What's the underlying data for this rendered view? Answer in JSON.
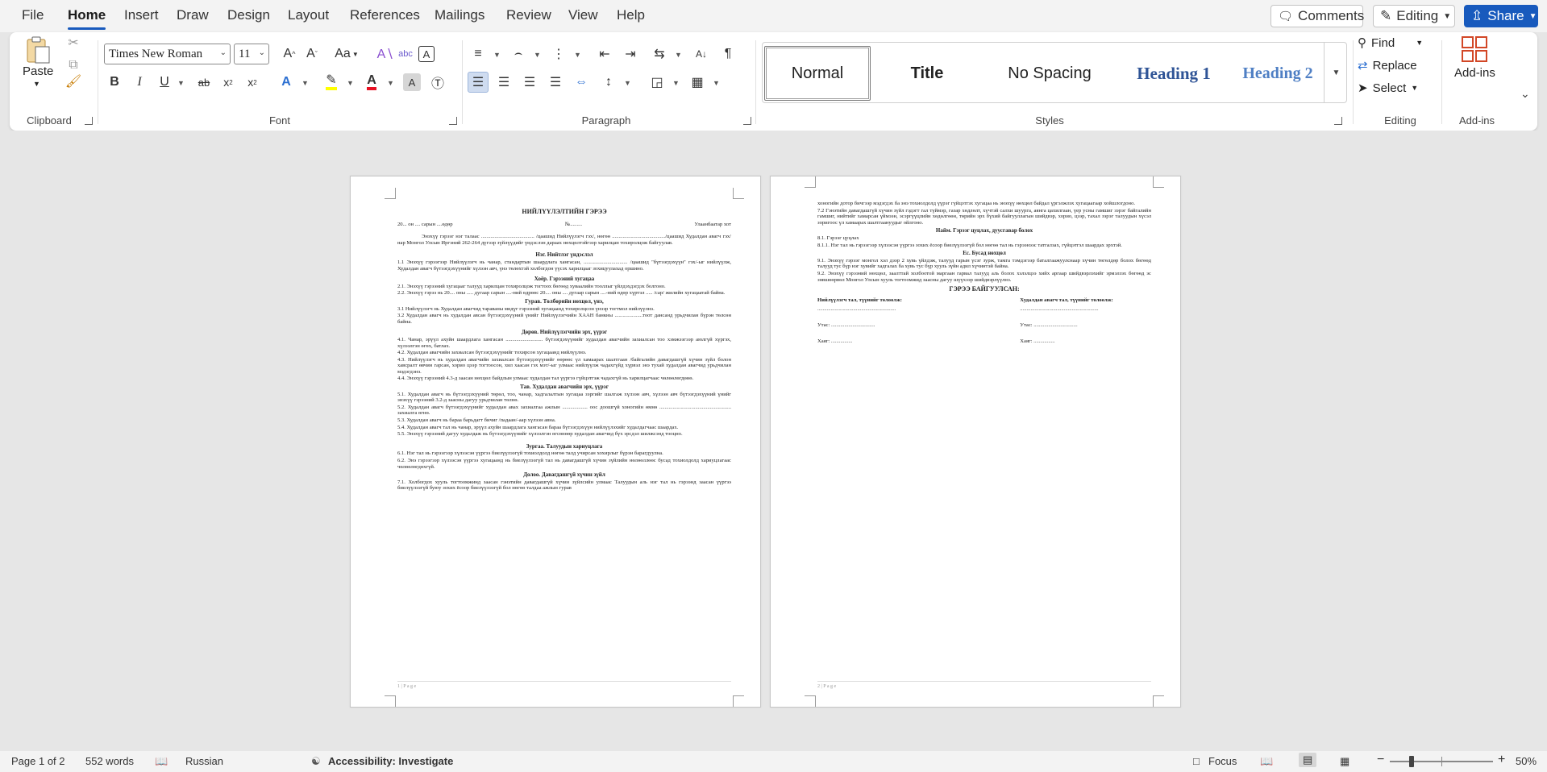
{
  "menu": {
    "tabs": [
      "File",
      "Home",
      "Insert",
      "Draw",
      "Design",
      "Layout",
      "References",
      "Mailings",
      "Review",
      "View",
      "Help"
    ],
    "comments_label": "Comments",
    "editing_label": "Editing",
    "share_label": "Share"
  },
  "ribbon": {
    "clipboard": {
      "paste_label": "Paste",
      "group_label": "Clipboard"
    },
    "font": {
      "font_name": "Times New Roman",
      "font_size": "11",
      "change_case": "Aa",
      "group_label": "Font"
    },
    "paragraph": {
      "group_label": "Paragraph"
    },
    "styles": {
      "group_label": "Styles",
      "items": [
        "Normal",
        "Title",
        "No Spacing",
        "Heading 1",
        "Heading 2"
      ]
    },
    "editing": {
      "find": "Find",
      "replace": "Replace",
      "select": "Select",
      "group_label": "Editing"
    },
    "addins": {
      "label": "Add-ins",
      "group_label": "Add-ins"
    }
  },
  "document": {
    "page1": {
      "title": "НИЙЛҮҮЛЭЛТИЙН ГЭРЭЭ",
      "date_line": "20... он .... сарын ....өдөр",
      "number": "№.........",
      "city": "Улаанбаатар хот",
      "intro": "Энэхүү гэрээг нэг талаас ........................................ /цаашид Нийлүүлэгч гэх/, нөгөө ......................................../цаашид Худалдан авагч гэх/ нар Монгол Улсын Иргэний 262-264 дүгээр зүйлүүдийг үндэслэн дараах нөхцөлтэйгээр харилцан тохиролцож байгуулав.",
      "s1_title": "Нэг. Нийтлэг үндэслэл",
      "s1_1": "1.1 Энэхүү гэрээгээр Нийлүүлэгч нь чанар, стандартын шаардлага хангасан, ................................. /цаашид \"бүтээгдэхүүн\" гэх/-ыг нийлүүлж, Худалдан авагч бүтээгдэхүүнийг хүлээн авч, үнэ төлөхтэй холбогдон үүсэх харилцааг зохицуулахад оршино.",
      "s2_title": "Хоёр. Гэрээний хугацаа",
      "s2_1": "2.1. Энэхүү гэрээний хугацааг талууд харилцан тохиролцож тогтоох бөгөөд хуваалийн тооллыг үйлдэхдэгдэх болгоно.",
      "s2_2": "2.2. Энэхүү гэрээ нь 20.... оны ..... дугаар сарын ....-ний өдрөөс 20.... оны .... дугаар сарын ....-ний өдөр хүртэл ..... /сар/ жилийн хугацаатай байна.",
      "s3_title": "Гурав. Төлбөрийн нөхцөл, үнэ,",
      "s3_1": "3.1 Нийлүүлэгч нь Худалдан авагчид тараваны мөдүг гэрээний хугацаанд тохиролцсон үнээр тогтмол нийлүүлнэ.",
      "s3_2": "3.2 Худалдан авагч нь худалдан авсан бүтээгдэхүүний үнийг Нийлүүлэгчийн ХААН банкны .....................тоот дансанд урьдчилан бүрэн төлсөн байна.",
      "s4_title": "Дөрөв. Нийлүүлэгчийн эрх, үүрэг",
      "s4_1": "4.1. Чанар, эрүүл ахуйн шаардлага хангасан ............................ бүтээгдэхүүнийг худалдан авагчийн захиалсан тоо хэмжээгээр аюлгүй хүргэх, хүлээлгэн өгөх, батлах.",
      "s4_2": "4.2. Худалдан авагчийн захиалсан бүтээгдэхүүнийг тохирсон хугацаанд нийлүүлнэ.",
      "s4_3": "4.3. Нийлүүлэгч нь худалдан авагчийн захиалсан бүтээгдэхүүнийг өөрөөс үл хамаарах шалтгаан /байгалийн давагдашгүй хүчин зүйл болон хавсралт өвчин гарсан, хорио цээр тогтоосон, хил хаасан гэх мэт/-ыг улмаас нийлүүлж чадахгүйд хүрвэл энэ тухай худалдан авагчид урьдчилан мэдэгдэнэ.",
      "s4_4": "4.4. Энэхүү гэрээний 4.3-д заасан нөхцөл байдлын улмаас худалдан тал үүргээ гүйцэтгэж чадахгүй нь харилцагчаас чөлөөлөгдөнө.",
      "s5_title": "Тав. Худалдан авагчийн эрх, үүрэг",
      "s5_1": "5.1. Худалдан авагч нь бүтээгдэхүүний төрөл, тоо, чанар, хадгалалтын хугацаа зэргийг шалгаж хүлээн авч, хүлээн авч бүтээгдэхүүний үнийг энэхүү гэрээний 3.2-д заасны дагуу урьдчилан төлнө.",
      "s5_2": "5.2. Худалдан авагч бүтээгдэхүүнийг худалдан авах захиалгаа ажлын ................... оос доошгүй хоногийн өмнө ...................................................... захиалга өгнө.",
      "s5_3": "5.3. Худалдан авагч нь бараа барьдагт бичиг /падаан/-аар хүлээн авна.",
      "s5_4": "5.4. Худалдан авагч тал нь чанар, эрүүл ахуйн шаардлага хангасан бараа бүтээгдэхүүн нийлүүлэхийг худалдагчаас шаардах.",
      "s5_5": "5.5. Энэхүү гэрээний дагуу худалдаж нь бүтээгдэхүүнийг хүлээлгэн өгсөнөөр худалдан авагчид бүх эрсдэл шилжсэнд тооцно.",
      "s6_title": "Зургаа. Талуудын хариуцлага",
      "s6_1": "6.1. Нэг тал нь гэрээгээр хүлээсэн үүргээ биелүүлээгүй тохиолдолд нөгөө талд учирсан хохирлыг бүрэн барагдуулна.",
      "s6_2": "6.2. Энэ гэрээгээр хүлээсэн үүргээ хугацаанд нь биелүүлээгүй тал нь давагдашгүй хүчин зүйлийн нөлөөллөөс бусад тохиолдолд хариуцлагаас чөлөөлөгдөхгүй.",
      "s7_title": "Долоо. Давагдашгүй хүчин зүйл",
      "s7_1": "7.1. Холбогдох хууль тогтоомжинд заасан гэнэтийн давагдашгүй хүчин зүйлсийн улмаас Талуудын аль нэг тал нь гэрээнд заасан үүргээ биелүүлээгүй буюу зохих ёсоор биелүүлээгүй бол нөгөө талдаа ажлын гурав",
      "footer": "1 | P a g e"
    },
    "page2": {
      "p1": "хоногийн дотор бичгээр мэдэгдэх ба энэ тохиолдолд үүрэг гүйцэтгэх хугацаа нь энэхүү нөхцөл байдал үргэлжлэх хугацаагаар хойшлогдоно.",
      "p2": "7.2 Гэнэтийн давагдашгүй хүчин зүйл гэдэгт гал түймэр, газар хөдлөлт, хүчтэй салхи шуурга, аянга цахилгаан, үер усны гамшиг зэрэг байгалийн гамшиг, нийтийг хамарсан үймээн, эсэргүүцлийн хөдөлгөөн, төрийн эрх бүхий байгууллагын шийдвэр, хорио, цээр, тахал зэрэг талуудын хүсэл зоригоос үл хамаарах шалтгаануудыг ойлгоно.",
      "s8_title": "Найм. Гэрээг цуцлах, дуусгавар болох",
      "s8_1": "8.1. Гэрээг цуцлах",
      "s8_1_1": "8.1.1. Нэг тал нь гэрээгээр хүлээсэн үүргээ зохих ёсоор биелүүлээгүй бол нөгөө тал нь гэрээнээс татгалзах, гүйцэтгэл шаардах эрхтэй.",
      "s9_title": "Ес. Бусад нөхцөл",
      "s9_1": "9.1. Энэхүү гэрээг монгол хэл дээр 2 хувь үйлдэж, талууд гарын үсэг зурж, тамга тэмдэгээр баталгаажуулснаар хүчин төгөлдөр болох бөгөөд талууд тус бүр нэг хувийг хадгалах ба хувь тус бүр хууль зүйн адил хүчинтэй байна.",
      "s9_2": "9.2. Энэхүү гэрээний нөхцөл, заалттай холбоотой маргаан гарвал талууд аль болох хэлэлцээ хийх аргаар шийдвэрлэхийг эрмэлзэх бөгөөд эс зөвшөөрвөл Монгол Улсын хууль тогтоомжид заасны дагуу шүүхээр шийдвэрлүүлнэ.",
      "sign_title": "ГЭРЭЭ БАЙГУУЛСАН:",
      "left_label": "Нийлүүлэгч тал, түүнийг төлөөлж:",
      "right_label": "Худалдан авагч тал, түүнийг төлөөлж:",
      "line": "...........................................................",
      "phone_left": "Утас: .................................",
      "phone_right": "Утас: .................................",
      "addr_left": "Хаяг: ................",
      "addr_right": "Хаяг: ................",
      "footer": "2 | P a g e"
    }
  },
  "status": {
    "page": "Page 1 of 2",
    "words": "552 words",
    "language": "Russian",
    "accessibility": "Accessibility: Investigate",
    "focus": "Focus",
    "zoom": "50%"
  },
  "colors": {
    "accent": "#185abd",
    "highlight": "#ffff00",
    "font_color": "#e81123"
  }
}
